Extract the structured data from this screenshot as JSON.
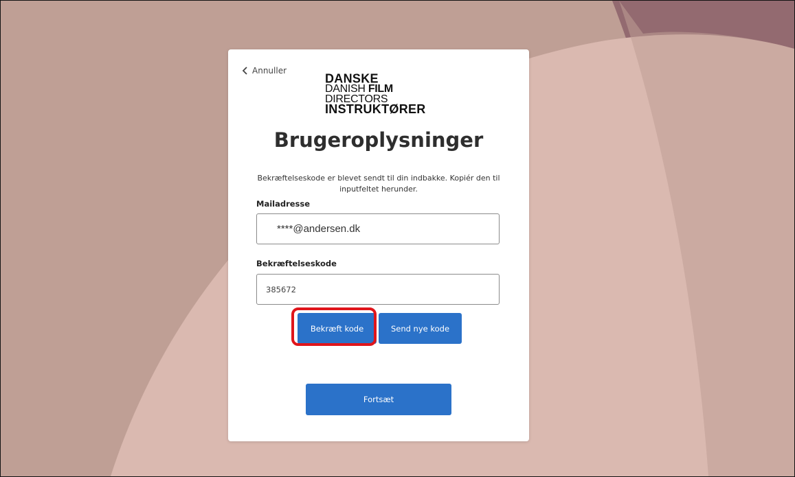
{
  "page": {
    "cancel_label": "Annuller",
    "title": "Brugeroplysninger",
    "intro_text": "Bekræftelseskode er blevet sendt til din indbakke. Kopiér den til inputfeltet herunder."
  },
  "logo": {
    "line1": "DANSKE",
    "line2_prefix": "DANISH ",
    "line2_bold": "FILM",
    "line2_suffix": " DIRECTORS",
    "line3": "INSTRUKTØRER"
  },
  "form": {
    "email_label": "Mailadresse",
    "email_value": "****@andersen.dk",
    "code_label": "Bekræftelseskode",
    "code_value": "385672"
  },
  "buttons": {
    "verify_code": "Bekræft kode",
    "send_new_code": "Send nye kode",
    "continue": "Fortsæt"
  },
  "colors": {
    "accent": "#2b72c9",
    "highlight": "#e0151b",
    "background": "#bf9f95"
  }
}
